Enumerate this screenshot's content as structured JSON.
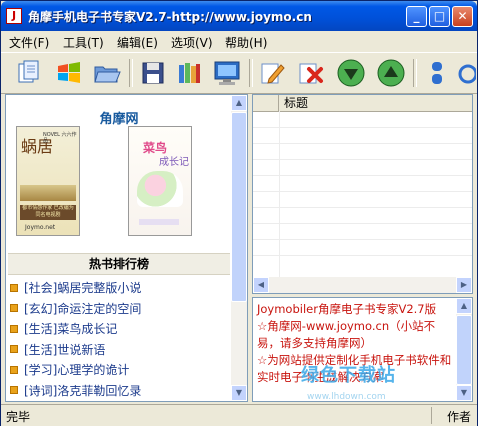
{
  "window": {
    "title": "角摩手机电子书专家V2.7-http://www.joymo.cn",
    "minimize": "_",
    "maximize": "□",
    "close": "✕"
  },
  "menu": [
    "文件(F)",
    "工具(T)",
    "编辑(E)",
    "选项(V)",
    "帮助(H)"
  ],
  "toolbar": {
    "icons": [
      "new-document-icon",
      "windows-logo-icon",
      "open-folder-icon",
      "save-disk-icon",
      "books-icon",
      "monitor-icon",
      "edit-pencil-icon",
      "delete-x-icon",
      "arrow-down-icon",
      "arrow-up-icon",
      "blue-capsule-icon",
      "refresh-icon"
    ]
  },
  "left_pane": {
    "site_title": "角摩网",
    "covers": [
      {
        "title": "蜗居",
        "subtitle": "NOVEL 六六作品",
        "band": "都市情感作家 已改编为同名电视剧",
        "footer": "Joymo.net"
      },
      {
        "title": "菜鸟",
        "subtitle": "成长记"
      }
    ],
    "hot_header": "热书排行榜",
    "rankings": [
      "[社会]蜗居完整版小说",
      "[玄幻]命运注定的空间",
      "[生活]菜鸟成长记",
      "[生活]世说新语",
      "[学习]心理学的诡计",
      "[诗词]洛克菲勒回忆录"
    ]
  },
  "file_list": {
    "columns": [
      "",
      "标题"
    ]
  },
  "info_panel": {
    "text": "Joymobiler角摩电子书专家V2.7版\n☆角摩网-www.joymo.cn（小站不易，请多支持角摩网）\n☆为网站提供定制化手机电子书软件和实时电子书生成解决方案"
  },
  "watermark": {
    "text": "绿色下载站",
    "url": "www.lhdown.com"
  },
  "status": {
    "left": "完毕",
    "right": "作者"
  },
  "colors": {
    "titlebar": "#0054e3",
    "info_text": "#c8140e",
    "site_title": "#185a9e",
    "link": "#1c3b8c"
  }
}
